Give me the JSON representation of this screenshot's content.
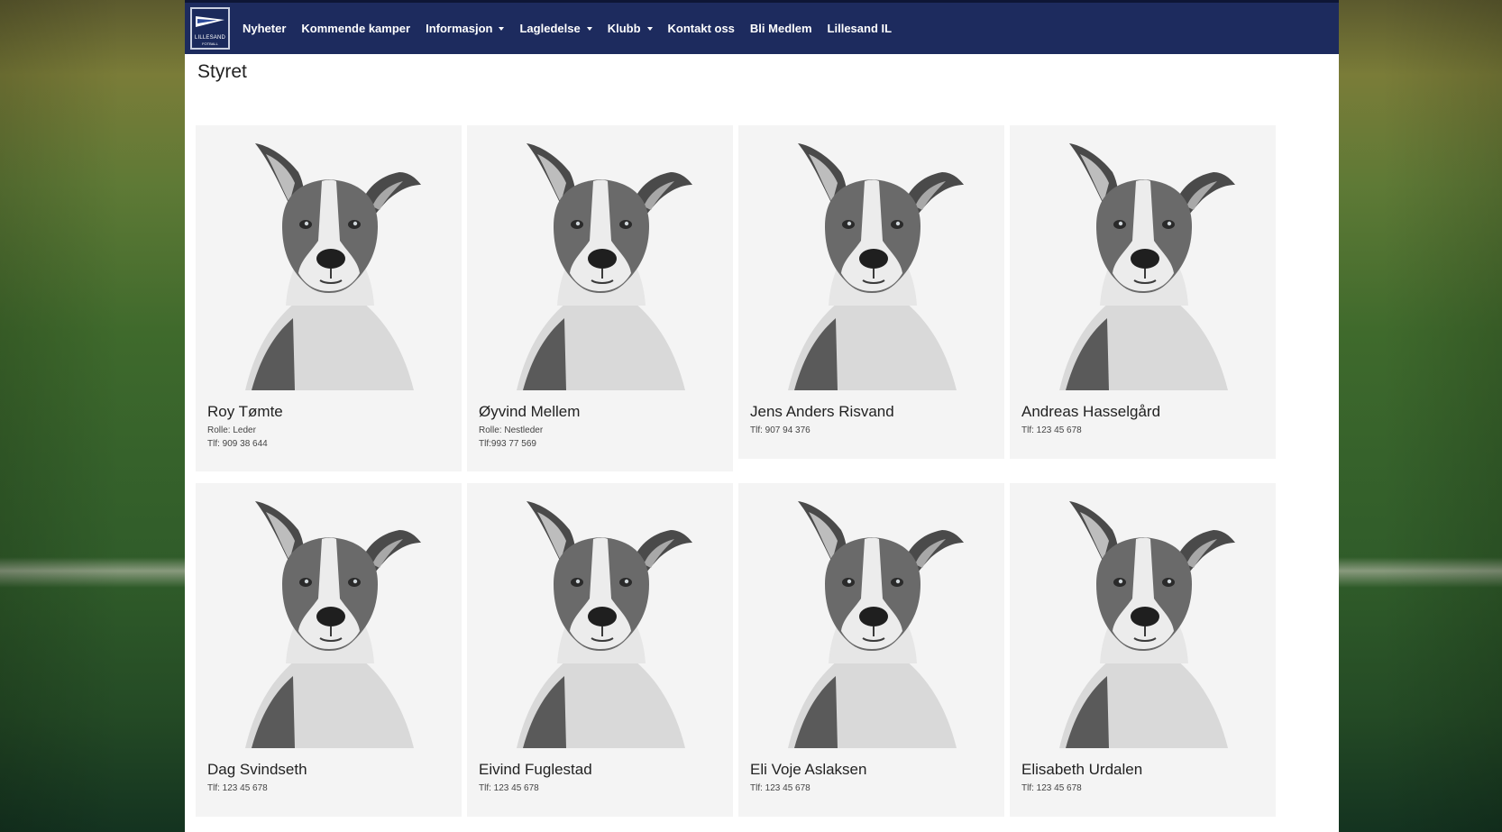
{
  "brand": {
    "logo_text": "LILLESAND",
    "logo_sub": "FOTBALL",
    "navy": "#1d2b5e"
  },
  "nav": [
    {
      "label": "Nyheter",
      "dropdown": false
    },
    {
      "label": "Kommende kamper",
      "dropdown": false
    },
    {
      "label": "Informasjon",
      "dropdown": true
    },
    {
      "label": "Lagledelse",
      "dropdown": true
    },
    {
      "label": "Klubb",
      "dropdown": true
    },
    {
      "label": "Kontakt oss",
      "dropdown": false
    },
    {
      "label": "Bli Medlem",
      "dropdown": false
    },
    {
      "label": "Lillesand IL",
      "dropdown": false
    }
  ],
  "page": {
    "title": "Styret"
  },
  "members": [
    {
      "name": "Roy Tømte",
      "lines": [
        "Rolle: Leder",
        "Tlf: 909 38 644"
      ]
    },
    {
      "name": "Øyvind Mellem",
      "lines": [
        "Rolle: Nestleder",
        "Tlf:993 77 569"
      ]
    },
    {
      "name": "Jens Anders Risvand",
      "lines": [
        "Tlf: 907 94 376"
      ]
    },
    {
      "name": "Andreas Hasselgård",
      "lines": [
        "Tlf: 123 45 678"
      ]
    },
    {
      "name": "Dag Svindseth",
      "lines": [
        "Tlf: 123 45 678"
      ]
    },
    {
      "name": "Eivind Fuglestad",
      "lines": [
        "Tlf: 123 45 678"
      ]
    },
    {
      "name": "Eli Voje Aslaksen",
      "lines": [
        "Tlf: 123 45 678"
      ]
    },
    {
      "name": "Elisabeth Urdalen",
      "lines": [
        "Tlf: 123 45 678"
      ]
    }
  ],
  "photo_icon": "dog-portrait"
}
